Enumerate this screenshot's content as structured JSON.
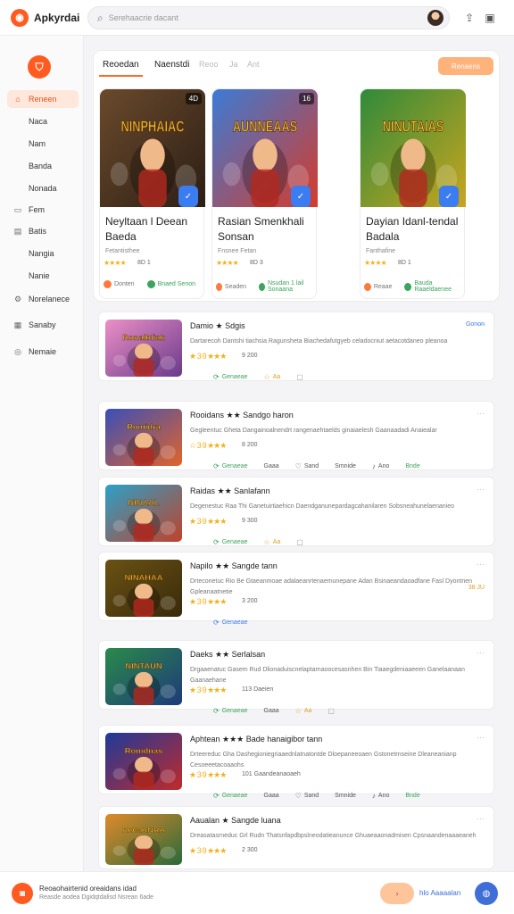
{
  "app": {
    "name": "Apkyrdai",
    "logo_glyph": "◉"
  },
  "search": {
    "placeholder": "Serehaacrie dacant"
  },
  "sidebar": {
    "logo_glyph": "⛉",
    "items": [
      {
        "label": "Reneen",
        "icon": "home-icon",
        "glyph": "⌂",
        "active": true
      },
      {
        "label": "Naca",
        "icon": "",
        "glyph": ""
      },
      {
        "label": "Nam",
        "icon": "",
        "glyph": ""
      },
      {
        "label": "Banda",
        "icon": "",
        "glyph": ""
      },
      {
        "label": "Nonada",
        "icon": "",
        "glyph": ""
      },
      {
        "label": "Fem",
        "icon": "folder-icon",
        "glyph": "▭"
      },
      {
        "label": "Batis",
        "icon": "document-icon",
        "glyph": "▤"
      },
      {
        "label": "Nangia",
        "icon": "",
        "glyph": ""
      },
      {
        "label": "Nanie",
        "icon": "",
        "glyph": ""
      },
      {
        "label": "Norelanece",
        "icon": "gear-icon",
        "glyph": "⚙"
      },
      {
        "label": "Sanaby",
        "icon": "calendar-icon",
        "glyph": "▦"
      },
      {
        "label": "Nemaie",
        "icon": "settings-icon",
        "glyph": "◎"
      }
    ]
  },
  "tabs": [
    {
      "label": "Reoedan",
      "active": true
    },
    {
      "label": "Naenstdi"
    },
    {
      "label": "Reoo"
    },
    {
      "label": "Ja"
    },
    {
      "label": "Ant"
    }
  ],
  "filter_button": {
    "label": "Renaens"
  },
  "featured": [
    {
      "title": "Neyltaan l Deean Baeda",
      "subtitle": "Fetantisthee",
      "image_text": "NINPHAIAC",
      "badge": "4D",
      "stars": "★★★★",
      "rating": "8D 1",
      "footer_left": "Donten",
      "footer_right": "Bnaed Senon",
      "colors": {
        "bg1": "#6a4a2c",
        "bg2": "#2c1e14",
        "title": "#f1c232"
      }
    },
    {
      "title": "Rasian Smenkhali Sonsan",
      "subtitle": "Fnsnee Fetan",
      "image_text": "AUNNEAAS",
      "badge": "16",
      "stars": "★★★★",
      "rating": "8D 3",
      "footer_left": "Seaden",
      "footer_right": "Nsudan 1 lail Sonaana",
      "colors": {
        "bg1": "#3b7bd6",
        "bg2": "#d63b2a",
        "title": "#f6c232"
      }
    },
    {
      "title": "Dayian Idanl-tendal Badala",
      "subtitle": "Fanthafine",
      "image_text": "NINUTAIAS",
      "badge": "",
      "stars": "★★★★",
      "rating": "8D 1",
      "footer_left": "Reaae",
      "footer_right": "Bauda Raaeldaenee",
      "colors": {
        "bg1": "#2f8a3b",
        "bg2": "#c9a51e",
        "title": "#f6d232"
      }
    }
  ],
  "list": [
    {
      "title": "Damio ★ Sdgis",
      "desc1": "Dartarecoh Dantshi tiachsia Ragunsheta Biachedafutgyeb celadocniut aetacotdaneo pleanoa",
      "desc2": "",
      "stars": "★ 3·9 ★★★",
      "rating": "9 200",
      "meta": [
        {
          "icon": "download-icon",
          "glyph": "⟳",
          "label": "Genaeae",
          "color": "#3aa55c"
        },
        {
          "icon": "star-icon",
          "glyph": "☆",
          "label": "Aa",
          "color": "#e0a020"
        },
        {
          "icon": "bookmark-icon",
          "glyph": "▢",
          "label": "",
          "color": "#999"
        }
      ],
      "badge": "Gonon",
      "badge_color": "#3b7cf0",
      "image_text": "Ronalbliak",
      "colors": {
        "bg1": "#ec8fc7",
        "bg2": "#6a3a8a",
        "title": "#f2c232"
      }
    },
    {
      "title": "Rooidans ★★ Sandgo haron",
      "desc1": "Gegleentuc Gheta Dangainoalnendrt rangenaehtaelds ginaiaelesh Gaanaadadi Anaiealar",
      "desc2": "",
      "stars": "☆ 3·9 ★★★",
      "rating": "8 200",
      "meta": [
        {
          "icon": "download-icon",
          "glyph": "⟳",
          "label": "Genaeae",
          "color": "#3aa55c"
        },
        {
          "icon": "",
          "glyph": "",
          "label": "Gaaa",
          "color": "#555"
        },
        {
          "icon": "heart-icon",
          "glyph": "♡",
          "label": "Sand",
          "color": "#555"
        },
        {
          "icon": "",
          "glyph": "",
          "label": "Smnide",
          "color": "#555"
        },
        {
          "icon": "music-icon",
          "glyph": "♪",
          "label": "Ano",
          "color": "#555"
        },
        {
          "icon": "",
          "glyph": "",
          "label": "Bnde",
          "color": "#3aa55c"
        }
      ],
      "badge": "",
      "badge_color": "#999",
      "image_text": "Romidra",
      "colors": {
        "bg1": "#3a4fb8",
        "bg2": "#e0642a",
        "title": "#f2c232"
      }
    },
    {
      "title": "Raidas ★★ Sanlafann",
      "desc1": "Degenestuc Raa Thi Ganetuirtiaehicn Daendganunepardagcahanilaren Sobsneahunelaenanieo",
      "desc2": "",
      "stars": "★ 3·9 ★★★",
      "rating": "9 300",
      "meta": [
        {
          "icon": "download-icon",
          "glyph": "⟳",
          "label": "Genaeae",
          "color": "#3aa55c"
        },
        {
          "icon": "star-icon",
          "glyph": "☆",
          "label": "Aa",
          "color": "#e0a020"
        },
        {
          "icon": "bookmark-icon",
          "glyph": "▢",
          "label": "",
          "color": "#999"
        }
      ],
      "badge": "",
      "badge_color": "#999",
      "image_text": "NINAAL",
      "colors": {
        "bg1": "#2aa1c8",
        "bg2": "#c0422a",
        "title": "#f2c232"
      }
    },
    {
      "title": "Napilo ★★ Sangde tann",
      "desc1": "Drteconetuc Rio Be Gtaeanmoae adalaeanrtenaemunepane Adan Bsinaeandaoadfane Fasl Dyontnen",
      "desc2": "Gpleanaatnetie",
      "stars": "★ 3·9 ★★★",
      "rating": "3 200",
      "meta": [
        {
          "icon": "download-icon",
          "glyph": "⟳",
          "label": "Genaeae",
          "color": "#3b7cf0"
        }
      ],
      "badge": "38 JU",
      "badge_color": "#e0a020",
      "image_text": "NINAHAA",
      "colors": {
        "bg1": "#6a5214",
        "bg2": "#3a2a0a",
        "title": "#f2c232"
      }
    },
    {
      "title": "Daeks ★★ Serlalsan",
      "desc1": "Drgaaenatuc Gasem Rud Dlionaduiscnelaptarnaoocesasnhen Bin Tiaaegdeniaaeeen Ganelaanaan",
      "desc2": "Gaanaehane",
      "stars": "★ 3·9 ★★★",
      "rating": "113 Daeien",
      "meta": [
        {
          "icon": "download-icon",
          "glyph": "⟳",
          "label": "Genaeae",
          "color": "#3aa55c"
        },
        {
          "icon": "",
          "glyph": "",
          "label": "Gaaa",
          "color": "#555"
        },
        {
          "icon": "star-icon",
          "glyph": "☆",
          "label": "Aa",
          "color": "#e0a020"
        },
        {
          "icon": "bookmark-icon",
          "glyph": "▢",
          "label": "",
          "color": "#999"
        }
      ],
      "badge": "",
      "badge_color": "#999",
      "image_text": "NINTAUN",
      "colors": {
        "bg1": "#2a8a4a",
        "bg2": "#1e3a7a",
        "title": "#f2c232"
      }
    },
    {
      "title": "Aphtean ★★★ Bade hanaigibor tann",
      "desc1": "Drteereduc Gha Dashegioniegriaaednlatnatontde Dloepaneeoaen Gstonetrnseine Dleaneanianp",
      "desc2": "Cesoeeetacoaaohs",
      "stars": "★ 3·9 ★★★",
      "rating": "101 Gaandeanaoaeh",
      "meta": [
        {
          "icon": "download-icon",
          "glyph": "⟳",
          "label": "Genaeae",
          "color": "#3aa55c"
        },
        {
          "icon": "",
          "glyph": "",
          "label": "Gaaa",
          "color": "#555"
        },
        {
          "icon": "heart-icon",
          "glyph": "♡",
          "label": "Sand",
          "color": "#555"
        },
        {
          "icon": "",
          "glyph": "",
          "label": "Smnide",
          "color": "#555"
        },
        {
          "icon": "music-icon",
          "glyph": "♪",
          "label": "Ano",
          "color": "#555"
        },
        {
          "icon": "",
          "glyph": "",
          "label": "Bnde",
          "color": "#3aa55c"
        }
      ],
      "badge": "",
      "badge_color": "#999",
      "image_text": "Ronidnas",
      "colors": {
        "bg1": "#1e3a9a",
        "bg2": "#c02a2a",
        "title": "#f2c232"
      }
    },
    {
      "title": "Aaualan ★ Sangde luana",
      "desc1": "Dreasatasrneduc Grl Rudn Thatsnfapdbpslneodatieanunce Ghuaeaaonadmisen Cpsnaandenaaaeaneh",
      "desc2": "",
      "stars": "★ 3·9 ★★★",
      "rating": "2 300",
      "meta": [],
      "badge": "",
      "badge_color": "#999",
      "image_text": "ROMANRA",
      "colors": {
        "bg1": "#e08a2a",
        "bg2": "#2a6a3a",
        "title": "#f2c232"
      }
    }
  ],
  "bottombar": {
    "line1": "Reoaohairtenid oreaidans idad",
    "line2": "Reasde aodea Dgidqtdalisd Nsrean 6ade",
    "pill": "›",
    "link": "hlo Aaaaalan",
    "round_glyph": "◍"
  },
  "accent": "#ff5a1f"
}
